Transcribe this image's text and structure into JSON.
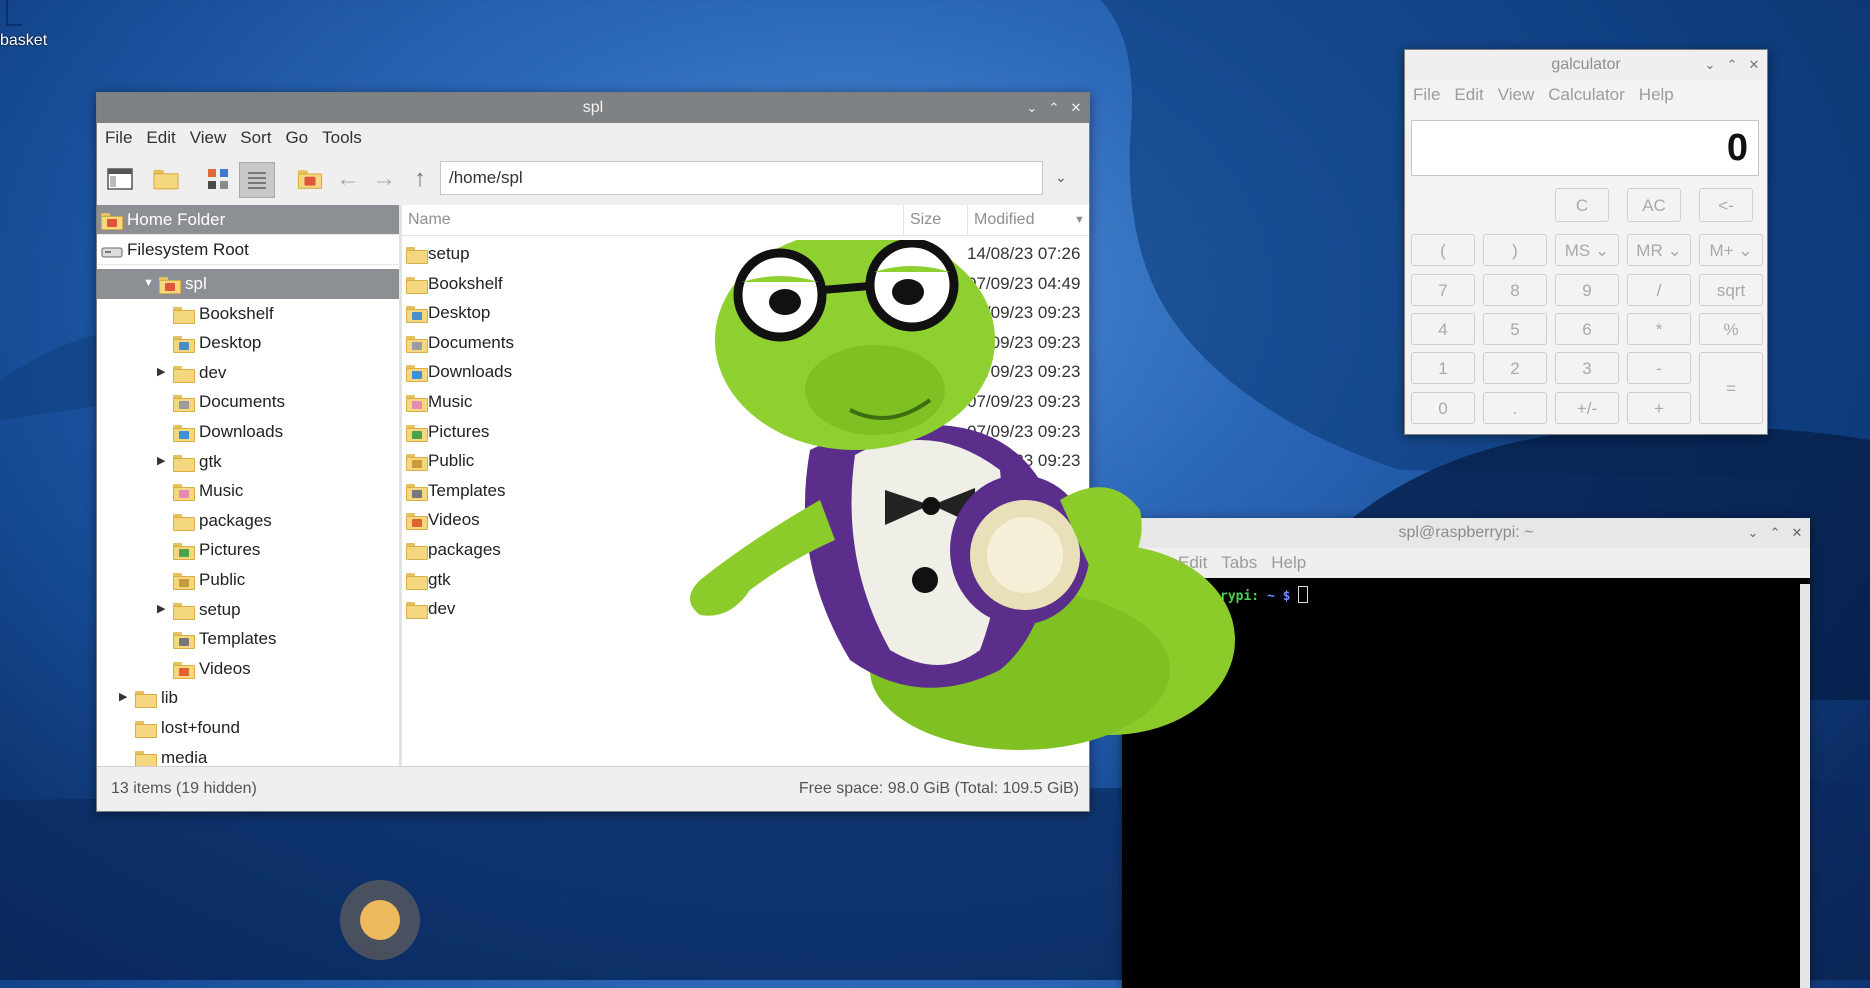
{
  "desktop": {
    "icon_label": "basket"
  },
  "file_manager": {
    "title": "spl",
    "menu": [
      "File",
      "Edit",
      "View",
      "Sort",
      "Go",
      "Tools"
    ],
    "address": "/home/spl",
    "places": [
      {
        "label": "Home Folder",
        "icon": "home-folder-icon",
        "selected": true
      },
      {
        "label": "Filesystem Root",
        "icon": "drive-icon",
        "selected": false
      }
    ],
    "tree": [
      {
        "label": "spl",
        "depth": 1,
        "expander": "expanded",
        "selected": true,
        "emblem": "home"
      },
      {
        "label": "Bookshelf",
        "depth": 2,
        "expander": "none",
        "emblem": ""
      },
      {
        "label": "Desktop",
        "depth": 2,
        "expander": "none",
        "emblem": "desktop"
      },
      {
        "label": "dev",
        "depth": 2,
        "expander": "collapsed",
        "emblem": ""
      },
      {
        "label": "Documents",
        "depth": 2,
        "expander": "none",
        "emblem": "documents"
      },
      {
        "label": "Downloads",
        "depth": 2,
        "expander": "none",
        "emblem": "downloads"
      },
      {
        "label": "gtk",
        "depth": 2,
        "expander": "collapsed",
        "emblem": ""
      },
      {
        "label": "Music",
        "depth": 2,
        "expander": "none",
        "emblem": "music"
      },
      {
        "label": "packages",
        "depth": 2,
        "expander": "none",
        "emblem": ""
      },
      {
        "label": "Pictures",
        "depth": 2,
        "expander": "none",
        "emblem": "pictures"
      },
      {
        "label": "Public",
        "depth": 2,
        "expander": "none",
        "emblem": "public"
      },
      {
        "label": "setup",
        "depth": 2,
        "expander": "collapsed",
        "emblem": ""
      },
      {
        "label": "Templates",
        "depth": 2,
        "expander": "none",
        "emblem": "templates"
      },
      {
        "label": "Videos",
        "depth": 2,
        "expander": "none",
        "emblem": "videos"
      },
      {
        "label": "lib",
        "depth": 1,
        "expander": "collapsed",
        "emblem": ""
      },
      {
        "label": "lost+found",
        "depth": 1,
        "expander": "none",
        "emblem": ""
      },
      {
        "label": "media",
        "depth": 1,
        "expander": "none",
        "emblem": ""
      }
    ],
    "columns": {
      "name": "Name",
      "size": "Size",
      "modified": "Modified"
    },
    "files": [
      {
        "name": "setup",
        "modified": "14/08/23 07:26",
        "emblem": ""
      },
      {
        "name": "Bookshelf",
        "modified": "07/09/23 04:49",
        "emblem": ""
      },
      {
        "name": "Desktop",
        "modified": "07/09/23 09:23",
        "emblem": "desktop"
      },
      {
        "name": "Documents",
        "modified": "07/09/23 09:23",
        "emblem": "documents"
      },
      {
        "name": "Downloads",
        "modified": "07/09/23 09:23",
        "emblem": "downloads"
      },
      {
        "name": "Music",
        "modified": "07/09/23 09:23",
        "emblem": "music"
      },
      {
        "name": "Pictures",
        "modified": "07/09/23 09:23",
        "emblem": "pictures"
      },
      {
        "name": "Public",
        "modified": "07/09/23 09:23",
        "emblem": "public"
      },
      {
        "name": "Templates",
        "modified": "",
        "emblem": "templates"
      },
      {
        "name": "Videos",
        "modified": "",
        "emblem": "videos"
      },
      {
        "name": "packages",
        "modified": "",
        "emblem": ""
      },
      {
        "name": "gtk",
        "modified": "",
        "emblem": ""
      },
      {
        "name": "dev",
        "modified": "",
        "emblem": ""
      }
    ],
    "status_left": "13 items (19 hidden)",
    "status_right": "Free space: 98.0 GiB (Total: 109.5 GiB)"
  },
  "calculator": {
    "title": "galculator",
    "menu": [
      "File",
      "Edit",
      "View",
      "Calculator",
      "Help"
    ],
    "display": "0",
    "top_buttons": [
      "C",
      "AC",
      "<-"
    ],
    "rows": [
      [
        "(",
        ")",
        "MS ⌄",
        "MR ⌄",
        "M+ ⌄"
      ],
      [
        "7",
        "8",
        "9",
        "/",
        "sqrt"
      ],
      [
        "4",
        "5",
        "6",
        "*",
        "%"
      ],
      [
        "1",
        "2",
        "3",
        "-"
      ],
      [
        "0",
        ".",
        "+/-",
        "+"
      ]
    ],
    "equals": "="
  },
  "terminal": {
    "title": "spl@raspberrypi: ~",
    "menu": [
      "Edit",
      "Tabs",
      "Help"
    ],
    "prompt_host": "rypi:",
    "prompt_path": "~",
    "prompt_symbol": "$"
  },
  "colors": {
    "selection": "#8c8f93",
    "folder": "#f4d77e",
    "prompt_green": "#4fd04f",
    "prompt_blue": "#6f8cff"
  }
}
